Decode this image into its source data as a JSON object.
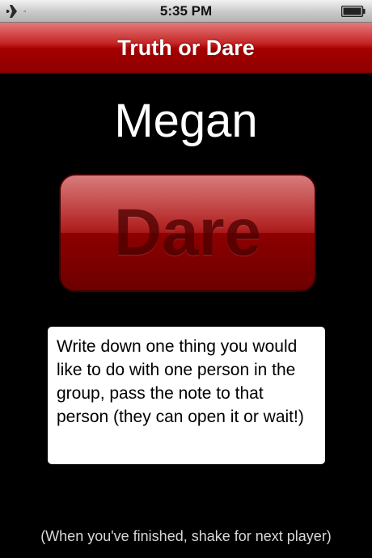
{
  "status_bar": {
    "time": "5:35 PM",
    "left_icon": "airplane-icon",
    "right_icon": "battery-icon"
  },
  "nav_bar": {
    "title": "Truth or Dare"
  },
  "player": {
    "name": "Megan"
  },
  "choice_button": {
    "label": "Dare"
  },
  "dare_card": {
    "text": "Write down one thing you would like to do with one person in the group, pass the note to that person (they can open it or wait!)"
  },
  "footer": {
    "hint": "(When you've finished, shake for next player)"
  },
  "colors": {
    "background": "#000000",
    "nav_red": "#a50000",
    "button_red": "#a40000",
    "card": "#ffffff"
  }
}
